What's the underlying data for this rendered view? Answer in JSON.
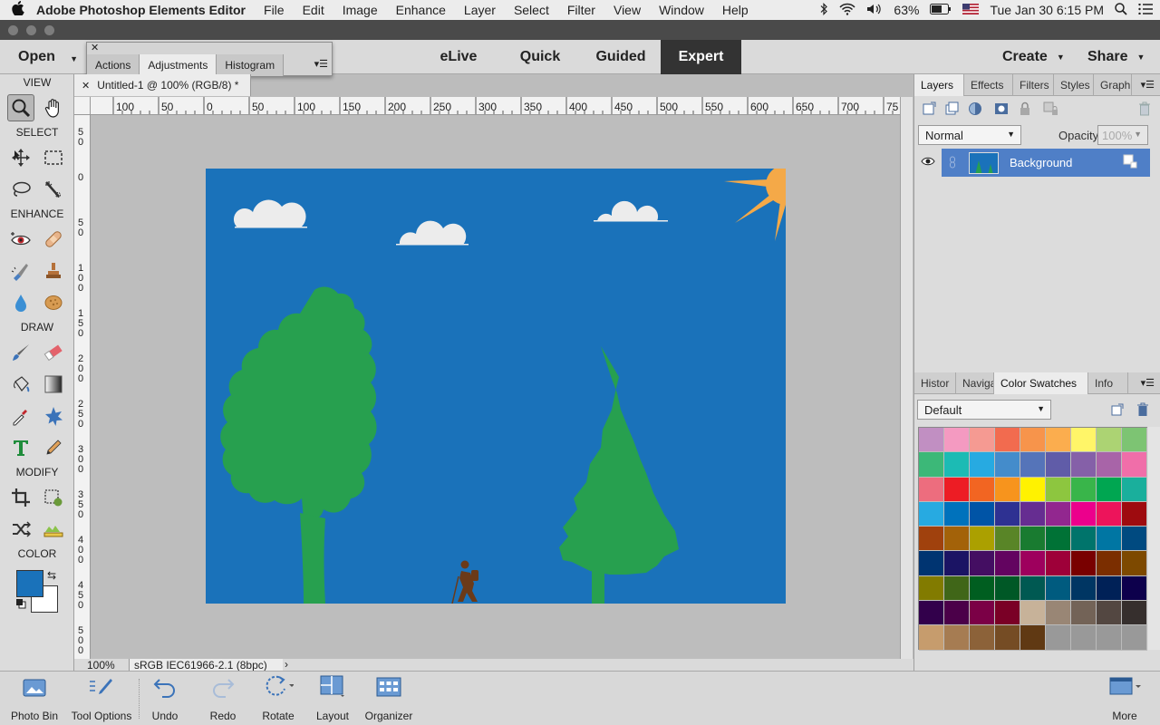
{
  "menubar": {
    "apple": "",
    "app_name": "Adobe Photoshop Elements Editor",
    "items": [
      "File",
      "Edit",
      "Image",
      "Enhance",
      "Layer",
      "Select",
      "Filter",
      "View",
      "Window",
      "Help"
    ],
    "battery": "63%",
    "datetime": "Tue Jan 30  6:15 PM"
  },
  "topbar": {
    "open_label": "Open",
    "modes": [
      "eLive",
      "Quick",
      "Guided",
      "Expert"
    ],
    "active_mode": "Expert",
    "create_label": "Create",
    "share_label": "Share"
  },
  "float_panel": {
    "tabs": [
      "Actions",
      "Adjustments",
      "Histogram"
    ],
    "active_tab": "Adjustments"
  },
  "toolbox": {
    "sections": {
      "view": "VIEW",
      "select": "SELECT",
      "enhance": "ENHANCE",
      "draw": "DRAW",
      "modify": "MODIFY",
      "color": "COLOR"
    },
    "foreground_color": "#1a72ba",
    "background_color": "#ffffff"
  },
  "document": {
    "tab_title": "Untitled-1 @ 100% (RGB/8) *",
    "ruler_top_labels": [
      "100",
      "50",
      "0",
      "50",
      "100",
      "150",
      "200",
      "250",
      "300",
      "350",
      "400",
      "450",
      "500",
      "550",
      "600",
      "650",
      "700",
      "75"
    ],
    "ruler_left_labels": [
      "5\n0",
      "0",
      "5\n0",
      "1\n0\n0",
      "1\n5\n0",
      "2\n0\n0",
      "2\n5\n0",
      "3\n0\n0",
      "3\n5\n0",
      "4\n0\n0",
      "4\n5\n0",
      "5\n0\n0"
    ],
    "sky_color": "#1a72ba",
    "tree_color": "#27a04f",
    "cloud_color": "#ececec",
    "sun_color": "#f4a948",
    "hiker_color": "#6b3a18"
  },
  "statusbar": {
    "zoom": "100%",
    "profile": "sRGB IEC61966-2.1 (8bpc)"
  },
  "layers_panel": {
    "tabs": [
      "Layers",
      "Effects",
      "Filters",
      "Styles",
      "Graphi"
    ],
    "active_tab": "Layers",
    "blend_mode": "Normal",
    "opacity_label": "Opacity:",
    "opacity_value": "100%",
    "layer_name": "Background"
  },
  "swatches_panel": {
    "tabs": [
      "Histor",
      "Naviga",
      "Color Swatches",
      "Info"
    ],
    "active_tab": "Color Swatches",
    "preset": "Default",
    "colors": [
      "#c18fc2",
      "#f49ac1",
      "#f59a92",
      "#f26b4f",
      "#f7944b",
      "#fbad4e",
      "#fff568",
      "#acd373",
      "#7dc473",
      "#3cb878",
      "#1cbbb4",
      "#27aae1",
      "#448ccb",
      "#5574b9",
      "#605ca8",
      "#8560a8",
      "#a864a8",
      "#f06ea9",
      "#ed6d7e",
      "#ed1c24",
      "#f26522",
      "#f7941d",
      "#fff200",
      "#8dc63f",
      "#39b54a",
      "#00a651",
      "#1aaf9c",
      "#27aae1",
      "#0072bc",
      "#0054a6",
      "#2e3192",
      "#662d91",
      "#92278f",
      "#ec008c",
      "#ed145b",
      "#9e0b0f",
      "#a0410d",
      "#a36209",
      "#aba000",
      "#598527",
      "#197b30",
      "#007236",
      "#00746b",
      "#0076a3",
      "#004a80",
      "#003471",
      "#1b1464",
      "#440e62",
      "#630460",
      "#9e005d",
      "#9e0039",
      "#790000",
      "#7b2e00",
      "#7d4900",
      "#827b00",
      "#406618",
      "#005e20",
      "#005826",
      "#005952",
      "#005b7f",
      "#003663",
      "#002157",
      "#0d004c",
      "#32004b",
      "#4b0049",
      "#7b0046",
      "#7a0026",
      "#c7b299",
      "#998675",
      "#736357",
      "#534741",
      "#362f2d",
      "#c69c6d",
      "#a67c52",
      "#8c6239",
      "#754c24",
      "#603913",
      "#999999",
      "#999999",
      "#999999",
      "#999999"
    ]
  },
  "taskbar": {
    "photo_bin": "Photo Bin",
    "tool_options": "Tool Options",
    "undo": "Undo",
    "redo": "Redo",
    "rotate": "Rotate",
    "layout": "Layout",
    "organizer": "Organizer",
    "more": "More"
  }
}
